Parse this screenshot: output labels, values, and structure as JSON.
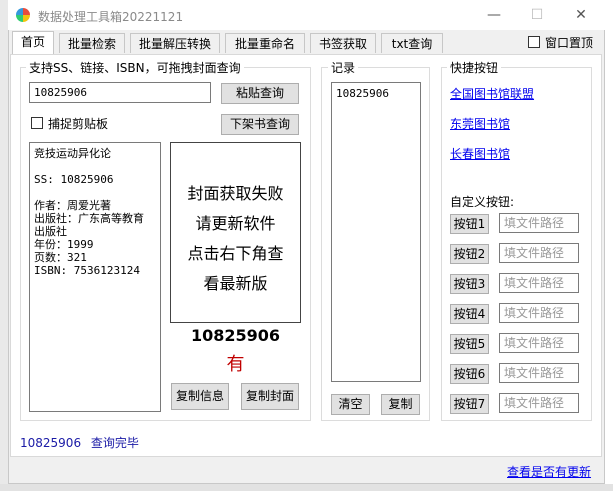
{
  "window": {
    "title": "数据处理工具箱20221121",
    "minimize": "—",
    "maximize": "☐",
    "close": "✕"
  },
  "tabs": [
    "首页",
    "批量检索",
    "批量解压转换",
    "批量重命名",
    "书签获取",
    "txt查询"
  ],
  "topmost_label": "窗口置顶",
  "search": {
    "group_label": "支持SS、链接、ISBN，可拖拽封面查询",
    "input_value": "10825906",
    "paste_query_button": "粘贴查询",
    "capture_clipboard_label": "捕捉剪贴板",
    "offshelf_button": "下架书查询"
  },
  "book_info": {
    "lines": [
      "竞技运动异化论",
      "",
      "SS: 10825906",
      "",
      "作者：周爱光著",
      "出版社：广东高等教育",
      "出版社",
      "年份：1999",
      "页数：321",
      "ISBN: 7536123124"
    ]
  },
  "cover": {
    "lines": [
      "封面获取失败",
      "请更新软件",
      "点击右下角查",
      "看最新版"
    ]
  },
  "result": {
    "ss_number": "10825906",
    "status": "有"
  },
  "copy_info_button": "复制信息",
  "copy_cover_button": "复制封面",
  "records": {
    "group_label": "记录",
    "items": [
      "10825906"
    ],
    "clear_button": "清空",
    "copy_button": "复制"
  },
  "shortcuts": {
    "group_label": "快捷按钮",
    "links": [
      "全国图书馆联盟",
      "东莞图书馆",
      "长春图书馆"
    ],
    "custom_label": "自定义按钮:",
    "custom_buttons": [
      {
        "label": "按钮1",
        "placeholder": "填文件路径"
      },
      {
        "label": "按钮2",
        "placeholder": "填文件路径"
      },
      {
        "label": "按钮3",
        "placeholder": "填文件路径"
      },
      {
        "label": "按钮4",
        "placeholder": "填文件路径"
      },
      {
        "label": "按钮5",
        "placeholder": "填文件路径"
      },
      {
        "label": "按钮6",
        "placeholder": "填文件路径"
      },
      {
        "label": "按钮7",
        "placeholder": "填文件路径"
      }
    ]
  },
  "status_line": {
    "ss": "10825906",
    "message": "查询完毕"
  },
  "update_link": "查看是否有更新",
  "colors": {
    "link": "#0000ee",
    "status_text": "#1a1aa6",
    "result_status": "#c00000"
  }
}
